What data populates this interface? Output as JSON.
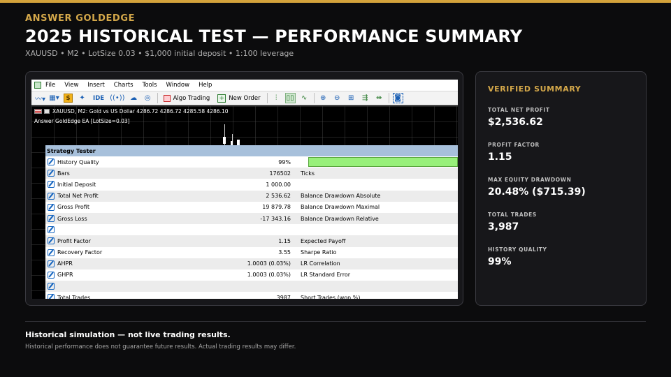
{
  "header": {
    "brand": "ANSWER GOLDEDGE",
    "title": "2025 HISTORICAL TEST — PERFORMANCE SUMMARY",
    "subtitle": "XAUUSD  •  M2  •  LotSize 0.03  •  $1,000 initial deposit  •  1:100 leverage"
  },
  "colors": {
    "accent": "#d4a33b",
    "background": "#0c0c0d",
    "card": "#17171a",
    "quality_bar": "#98f07a",
    "tester_header": "#a7c0db"
  },
  "terminal": {
    "menu": [
      "File",
      "View",
      "Insert",
      "Charts",
      "Tools",
      "Window",
      "Help"
    ],
    "toolbar": {
      "ide_label": "IDE",
      "algo_trading_label": "Algo Trading",
      "new_order_label": "New Order"
    },
    "chart_info_line1": "XAUUSD, M2:  Gold vs US Dollar  4286.72 4286.72 4285.58 4286.10",
    "chart_info_line2": "Answer GoldEdge EA [LotSize=0.03]",
    "tester": {
      "title": "Strategy Tester",
      "rows": [
        {
          "label": "History Quality",
          "value": "99%",
          "label2": ""
        },
        {
          "label": "Bars",
          "value": "176502",
          "label2": "Ticks"
        },
        {
          "label": "Initial Deposit",
          "value": "1 000.00",
          "label2": ""
        },
        {
          "label": "Total Net Profit",
          "value": "2 536.62",
          "label2": "Balance Drawdown Absolute"
        },
        {
          "label": "Gross Profit",
          "value": "19 879.78",
          "label2": "Balance Drawdown Maximal"
        },
        {
          "label": "Gross Loss",
          "value": "-17 343.16",
          "label2": "Balance Drawdown Relative"
        },
        {
          "label": "",
          "value": "",
          "label2": ""
        },
        {
          "label": "Profit Factor",
          "value": "1.15",
          "label2": "Expected Payoff"
        },
        {
          "label": "Recovery Factor",
          "value": "3.55",
          "label2": "Sharpe Ratio"
        },
        {
          "label": "AHPR",
          "value": "1.0003 (0.03%)",
          "label2": "LR Correlation"
        },
        {
          "label": "GHPR",
          "value": "1.0003 (0.03%)",
          "label2": "LR Standard Error"
        },
        {
          "label": "",
          "value": "",
          "label2": ""
        },
        {
          "label": "Total Trades",
          "value": "3987",
          "label2": "Short Trades (won %)"
        }
      ],
      "history_quality_fraction": 0.99
    }
  },
  "summary": {
    "title": "VERIFIED SUMMARY",
    "metrics": [
      {
        "label": "TOTAL NET PROFIT",
        "value": "$2,536.62"
      },
      {
        "label": "PROFIT FACTOR",
        "value": "1.15"
      },
      {
        "label": "MAX EQUITY DRAWDOWN",
        "value": "20.48%  ($715.39)"
      },
      {
        "label": "TOTAL TRADES",
        "value": "3,987"
      },
      {
        "label": "HISTORY QUALITY",
        "value": "99%"
      }
    ]
  },
  "footer": {
    "disclaimer": "Historical simulation — not live trading results.",
    "note": "Historical performance does not guarantee future results. Actual trading results may differ."
  }
}
